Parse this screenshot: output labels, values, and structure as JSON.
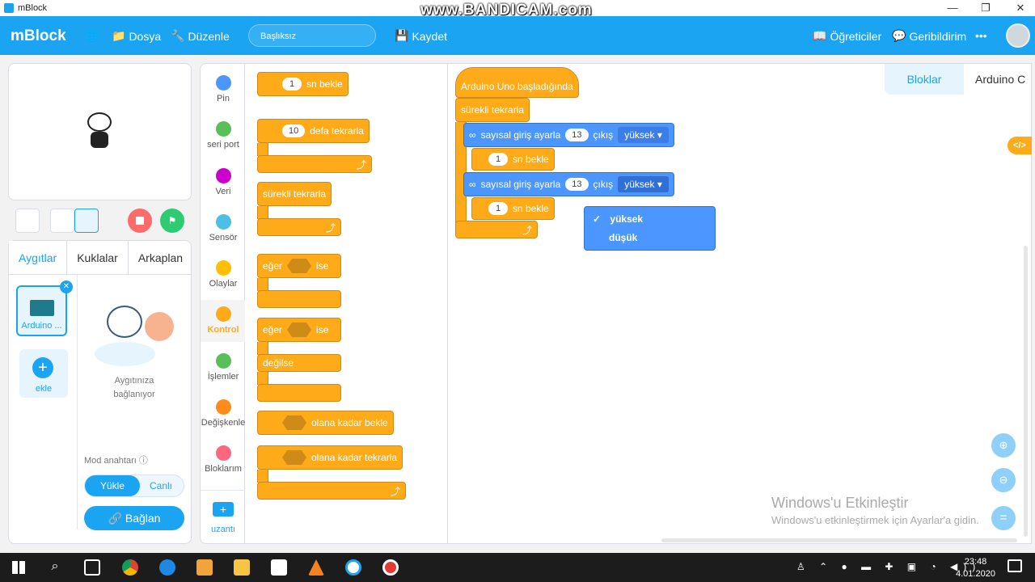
{
  "window": {
    "title": "mBlock",
    "watermark": "www.BANDICAM.com"
  },
  "menubar": {
    "logo": "mBlock",
    "file": "Dosya",
    "edit": "Düzenle",
    "project": "Başlıksız",
    "save": "Kaydet",
    "tutorials": "Öğreticiler",
    "feedback": "Geribildirim",
    "more": "•••"
  },
  "colors": {
    "accent": "#1ba4f1",
    "control": "#ffab19",
    "pin": "#4c97ff"
  },
  "devices": {
    "tabs": [
      "Aygıtlar",
      "Kuklalar",
      "Arkaplan"
    ],
    "device_name": "Arduino ...",
    "add": "ekle",
    "connecting": "Aygıtınıza bağlanıyor",
    "mode_label": "Mod anahtarı",
    "mode_upload": "Yükle",
    "mode_live": "Canlı",
    "connect": "Bağlan"
  },
  "categories": [
    {
      "label": "Pin",
      "color": "#4c97ff"
    },
    {
      "label": "seri port",
      "color": "#59c059"
    },
    {
      "label": "Veri",
      "color": "#c0c"
    },
    {
      "label": "Sensör",
      "color": "#4cbfe6"
    },
    {
      "label": "Olaylar",
      "color": "#ffbf00"
    },
    {
      "label": "Kontrol",
      "color": "#ffab19"
    },
    {
      "label": "İşlemler",
      "color": "#59c059"
    },
    {
      "label": "Değişkenle",
      "color": "#ff8c1a"
    },
    {
      "label": "Bloklarım",
      "color": "#ff6680"
    }
  ],
  "extension": "uzantı",
  "palette": {
    "wait_val": "1",
    "wait": "sn bekle",
    "repeat_val": "10",
    "repeat": "defa tekrarla",
    "forever": "sürekli tekrarla",
    "if": "eğer",
    "then": "ise",
    "else": "değilse",
    "wait_until": "olana kadar bekle",
    "repeat_until": "olana kadar tekrarla"
  },
  "workspace": {
    "tabs": [
      "Bloklar",
      "Arduino C"
    ],
    "hat": "Arduino Uno başladığında",
    "forever": "sürekli tekrarla",
    "set_pin": "sayısal giriş ayarla",
    "pin": "13",
    "output": "çıkış",
    "level": "yüksek",
    "wait_val": "1",
    "wait": "sn bekle",
    "menu": [
      "yüksek",
      "düşük"
    ],
    "code_icon": "</>"
  },
  "activation": {
    "title": "Windows'u Etkinleştir",
    "sub": "Windows'u etkinleştirmek için Ayarlar'a gidin."
  },
  "taskbar": {
    "time": "23:48",
    "date": "4.01.2020"
  }
}
